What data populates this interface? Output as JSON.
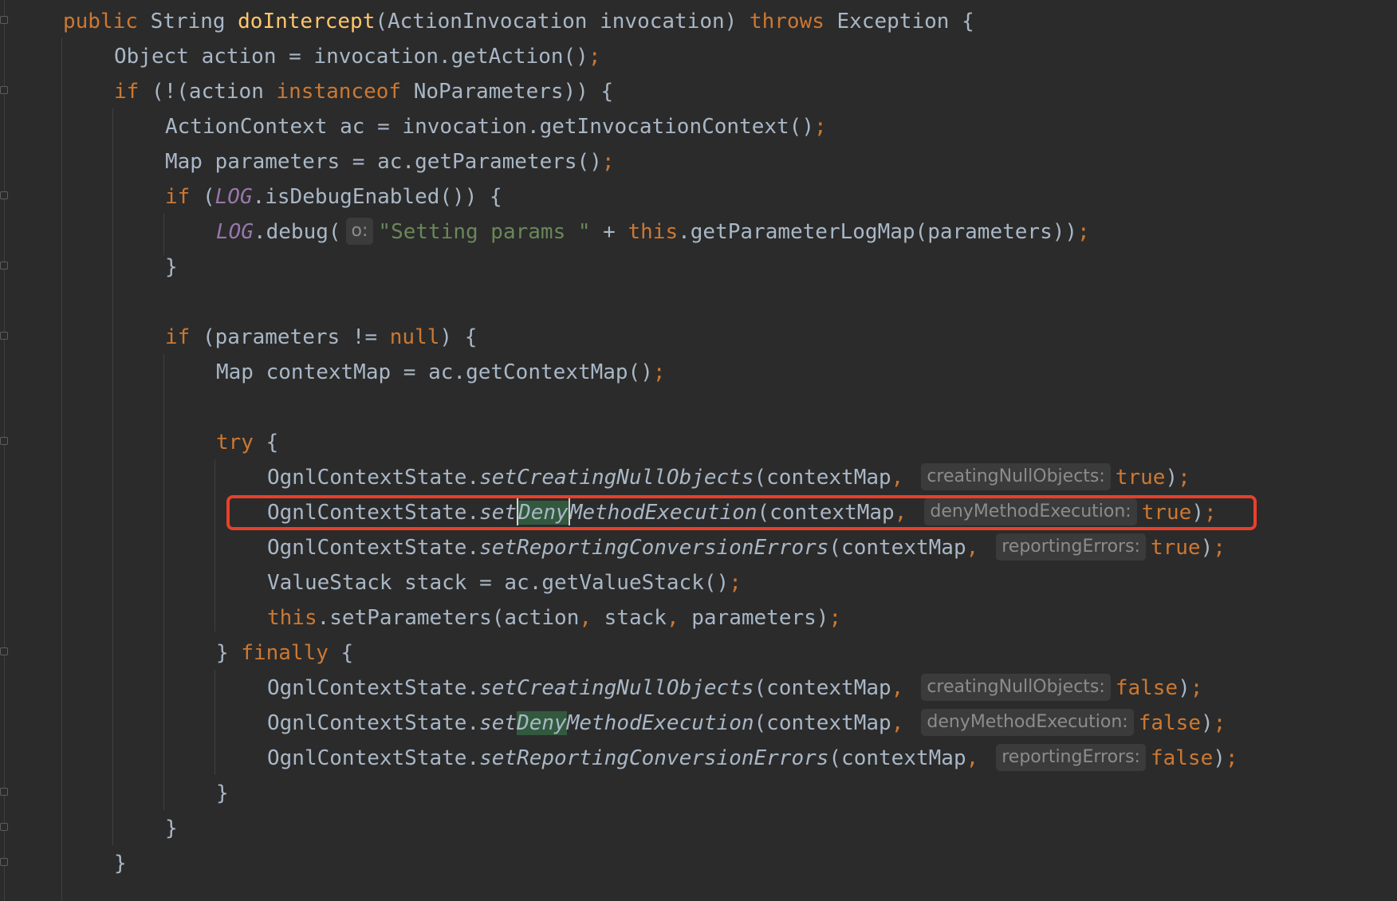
{
  "editor": {
    "lines": {
      "l1": {
        "kw_public": "public",
        "type_string": "String",
        "fn_name": "doIntercept",
        "params": "(ActionInvocation invocation)",
        "kw_throws": "throws",
        "rest": "Exception {"
      },
      "l2": {
        "text": "Object action = invocation.getAction()",
        "semi": ";"
      },
      "l3": {
        "kw_if": "if",
        "pre": " (!(action ",
        "kw_instanceof": "instanceof",
        "post": " NoParameters)) {"
      },
      "l4": {
        "text": "ActionContext ac = invocation.getInvocationContext()",
        "semi": ";"
      },
      "l5": {
        "text": "Map parameters = ac.getParameters()",
        "semi": ";"
      },
      "l6": {
        "kw_if": "if",
        "pre": " (",
        "const": "LOG",
        "post": ".isDebugEnabled()) {"
      },
      "l7": {
        "const": "LOG",
        "call": ".debug(",
        "hint": "o:",
        "str": "\"Setting params \"",
        "plus": " + ",
        "kw_this": "this",
        "post": ".getParameterLogMap(parameters))",
        "semi": ";"
      },
      "l8": {
        "text": "}"
      },
      "l10": {
        "kw_if": "if",
        "pre": " (parameters != ",
        "kw_null": "null",
        "post": ") {"
      },
      "l11": {
        "text": "Map contextMap = ac.getContextMap()",
        "semi": ";"
      },
      "l13": {
        "kw_try": "try",
        "post": " {"
      },
      "l14": {
        "cls": "OgnlContextState.",
        "method": "setCreatingNullObjects",
        "args": "(contextMap",
        "comma": ",",
        "hint": "creatingNullObjects:",
        "val": "true",
        "close": ")",
        "semi": ";"
      },
      "l15": {
        "cls": "OgnlContextState.",
        "m1": "set",
        "m2": "Deny",
        "m3": "MethodExecution",
        "args": "(contextMap",
        "comma": ",",
        "hint": "denyMethodExecution:",
        "val": "true",
        "close": ")",
        "semi": ";"
      },
      "l16": {
        "cls": "OgnlContextState.",
        "method": "setReportingConversionErrors",
        "args": "(contextMap",
        "comma": ",",
        "hint": "reportingErrors:",
        "val": "true",
        "close": ")",
        "semi": ";"
      },
      "l17": {
        "text": "ValueStack stack = ac.getValueStack()",
        "semi": ";"
      },
      "l18": {
        "kw_this": "this",
        "pre": ".setParameters(action",
        "c1": ",",
        "mid": " stack",
        "c2": ",",
        "post": " parameters)",
        "semi": ";"
      },
      "l19": {
        "pre": "} ",
        "kw_finally": "finally",
        "post": " {"
      },
      "l20": {
        "cls": "OgnlContextState.",
        "method": "setCreatingNullObjects",
        "args": "(contextMap",
        "comma": ",",
        "hint": "creatingNullObjects:",
        "val": "false",
        "close": ")",
        "semi": ";"
      },
      "l21": {
        "cls": "OgnlContextState.",
        "m1": "set",
        "m2": "Deny",
        "m3": "MethodExecution",
        "args": "(contextMap",
        "comma": ",",
        "hint": "denyMethodExecution:",
        "val": "false",
        "close": ")",
        "semi": ";"
      },
      "l22": {
        "cls": "OgnlContextState.",
        "method": "setReportingConversionErrors",
        "args": "(contextMap",
        "comma": ",",
        "hint": "reportingErrors:",
        "val": "false",
        "close": ")",
        "semi": ";"
      },
      "l23": {
        "text": "}"
      },
      "l24": {
        "text": "}"
      },
      "l25": {
        "text": "}"
      }
    },
    "colors": {
      "background": "#2b2b2b",
      "text": "#a9b7c6",
      "keyword": "#cc7832",
      "function": "#ffc66d",
      "constant": "#9876aa",
      "string": "#6a8759",
      "hint_text": "#8c8c8c",
      "hint_bg": "#3b3b3b",
      "selection_highlight": "#32593d",
      "annotation_box": "#e8402b"
    }
  }
}
